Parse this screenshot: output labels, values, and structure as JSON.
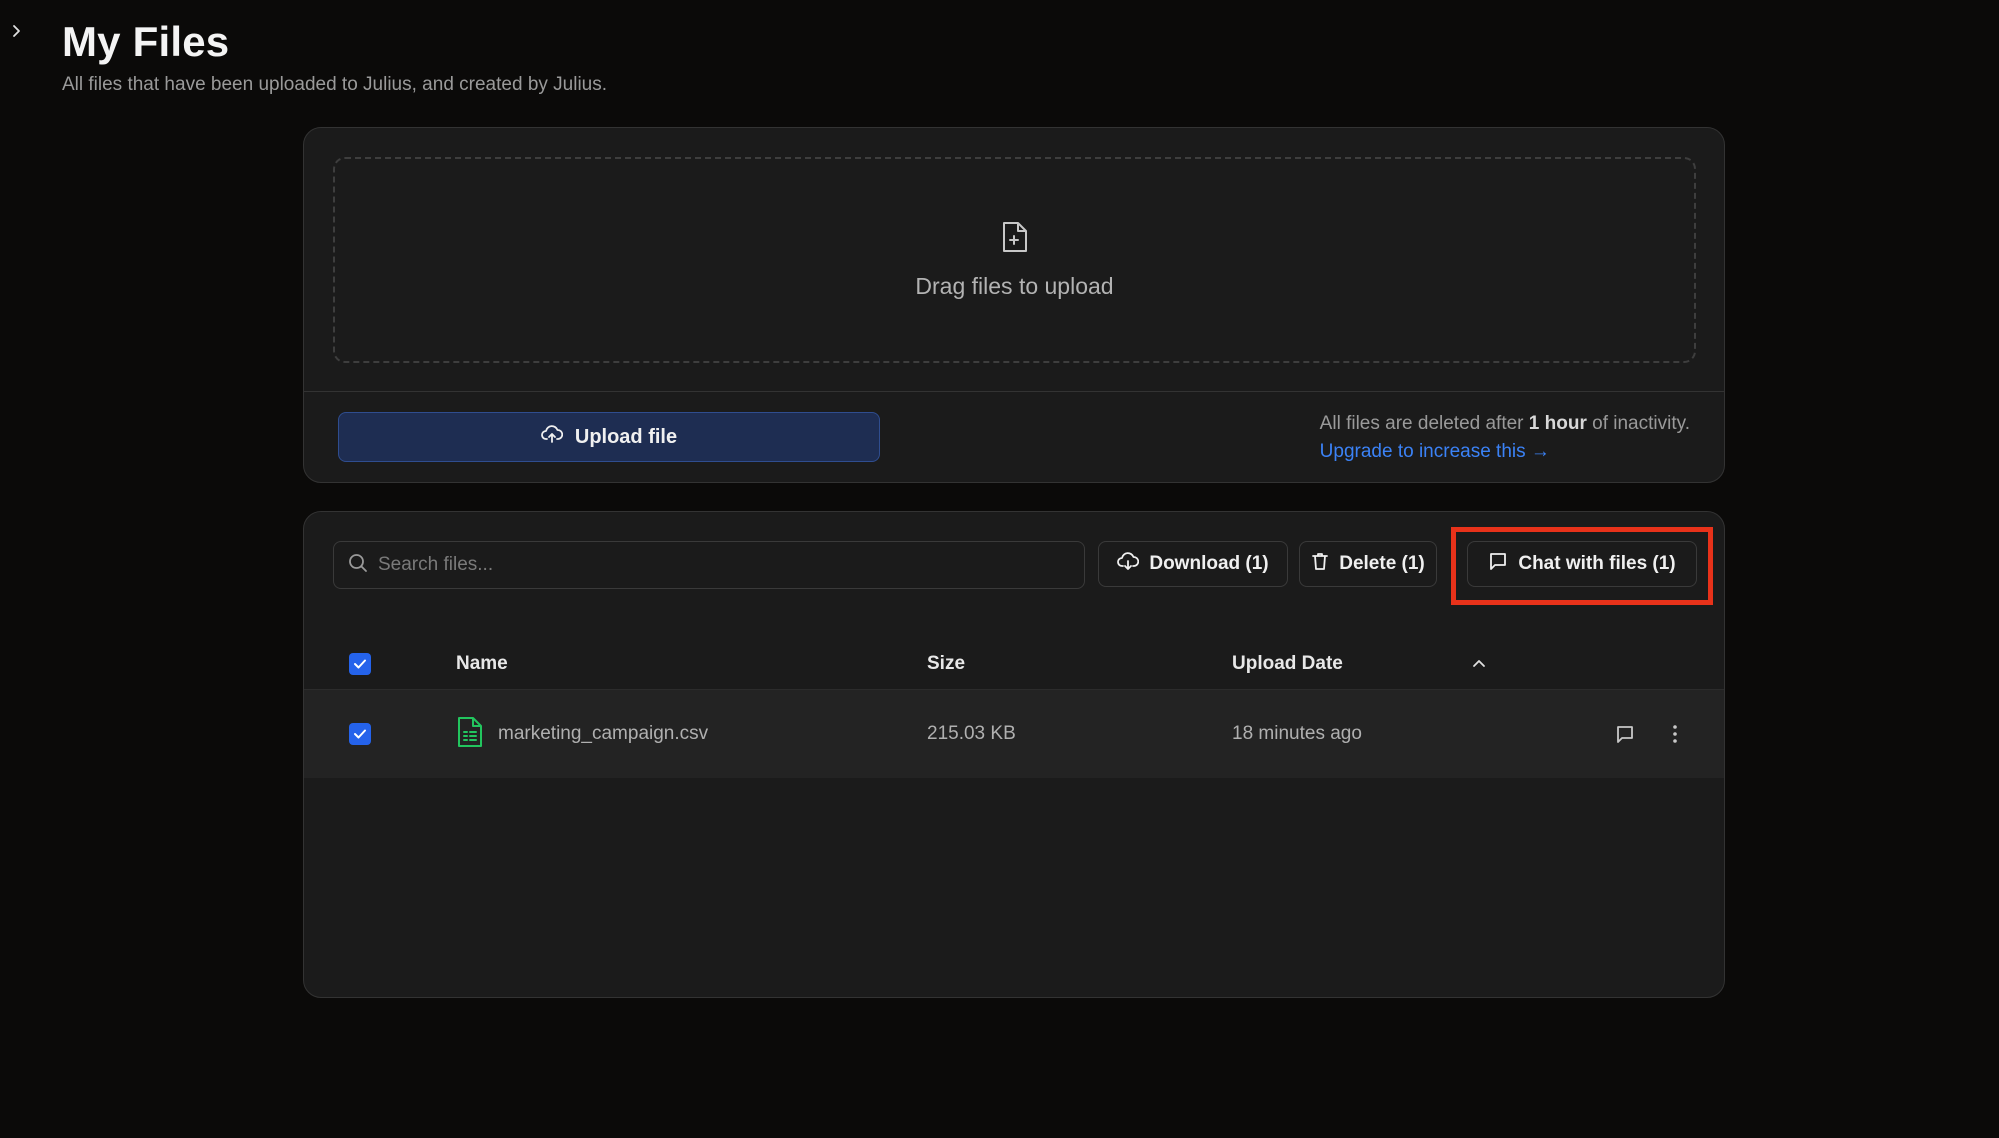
{
  "header": {
    "title": "My Files",
    "subtitle": "All files that have been uploaded to Julius, and created by Julius."
  },
  "upload": {
    "dropzone_text": "Drag files to upload",
    "button_label": "Upload file",
    "retention_prefix": "All files are deleted after ",
    "retention_bold": "1 hour",
    "retention_suffix": " of inactivity.",
    "upgrade_link": "Upgrade to increase this →"
  },
  "files": {
    "search_placeholder": "Search files...",
    "actions": {
      "download": "Download (1)",
      "delete": "Delete (1)",
      "chat": "Chat with files (1)"
    },
    "columns": {
      "name": "Name",
      "size": "Size",
      "upload_date": "Upload Date"
    },
    "rows": [
      {
        "name": "marketing_campaign.csv",
        "size": "215.03 KB",
        "upload_date": "18 minutes ago",
        "checked": true
      }
    ]
  },
  "colors": {
    "accent": "#2563eb",
    "link": "#3b82f6",
    "highlight": "#e8321a",
    "csv_icon": "#22c55e"
  }
}
